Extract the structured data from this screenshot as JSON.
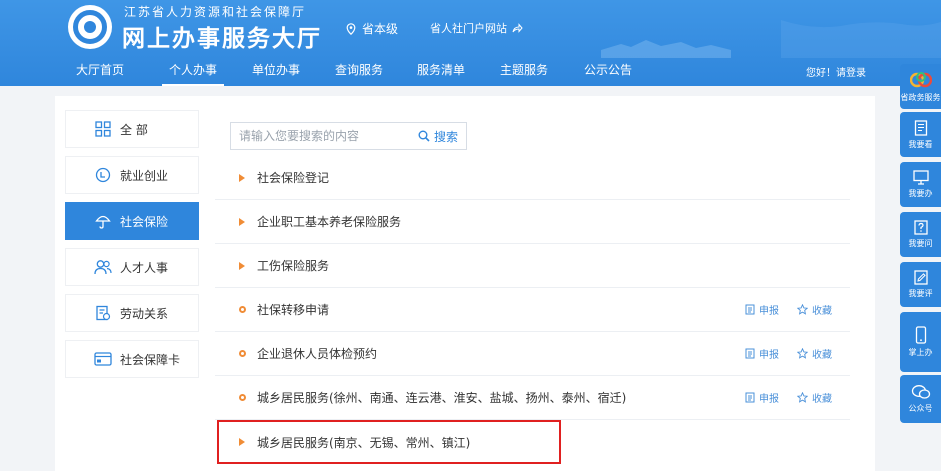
{
  "header": {
    "org_name": "江苏省人力资源和社会保障厅",
    "site_name": "网上办事服务大厅",
    "region": "省本级",
    "portal_link": "省人社门户网站",
    "greeting": "您好！请登录"
  },
  "nav": {
    "items": [
      {
        "label": "大厅首页"
      },
      {
        "label": "个人办事",
        "active": true
      },
      {
        "label": "单位办事"
      },
      {
        "label": "查询服务"
      },
      {
        "label": "服务清单"
      },
      {
        "label": "主题服务"
      },
      {
        "label": "公示公告"
      }
    ]
  },
  "left_menu": {
    "items": [
      {
        "label": "全 部",
        "icon": "grid-icon"
      },
      {
        "label": "就业创业",
        "icon": "briefcase-icon"
      },
      {
        "label": "社会保险",
        "icon": "umbrella-icon",
        "active": true
      },
      {
        "label": "人才人事",
        "icon": "people-icon"
      },
      {
        "label": "劳动关系",
        "icon": "document-icon"
      },
      {
        "label": "社会保障卡",
        "icon": "card-icon"
      }
    ]
  },
  "search": {
    "placeholder": "请输入您要搜索的内容",
    "button_label": "搜索"
  },
  "services": [
    {
      "label": "社会保险登记",
      "marker": "triangle"
    },
    {
      "label": "企业职工基本养老保险服务",
      "marker": "triangle"
    },
    {
      "label": "工伤保险服务",
      "marker": "triangle"
    },
    {
      "label": "社保转移申请",
      "marker": "circle",
      "apply": "申报",
      "favorite": "收藏"
    },
    {
      "label": "企业退休人员体检预约",
      "marker": "circle",
      "apply": "申报",
      "favorite": "收藏"
    },
    {
      "label": "城乡居民服务(徐州、南通、连云港、淮安、盐城、扬州、泰州、宿迁)",
      "marker": "circle",
      "apply": "申报",
      "favorite": "收藏"
    },
    {
      "label": "城乡居民服务(南京、无锡、常州、镇江)",
      "marker": "triangle",
      "highlighted": true
    }
  ],
  "right_bar": {
    "items": [
      {
        "label": "省政务服务",
        "icon": "gov-service-icon"
      },
      {
        "label": "我要看",
        "icon": "book-icon"
      },
      {
        "label": "我要办",
        "icon": "monitor-icon"
      },
      {
        "label": "我要问",
        "icon": "question-icon"
      },
      {
        "label": "我要评",
        "icon": "edit-icon"
      },
      {
        "label": "掌上办",
        "icon": "phone-icon"
      },
      {
        "label": "公众号",
        "icon": "wechat-icon"
      }
    ]
  },
  "colors": {
    "primary": "#2f86dc",
    "marker": "#f08c36",
    "highlight_border": "#e02020"
  }
}
